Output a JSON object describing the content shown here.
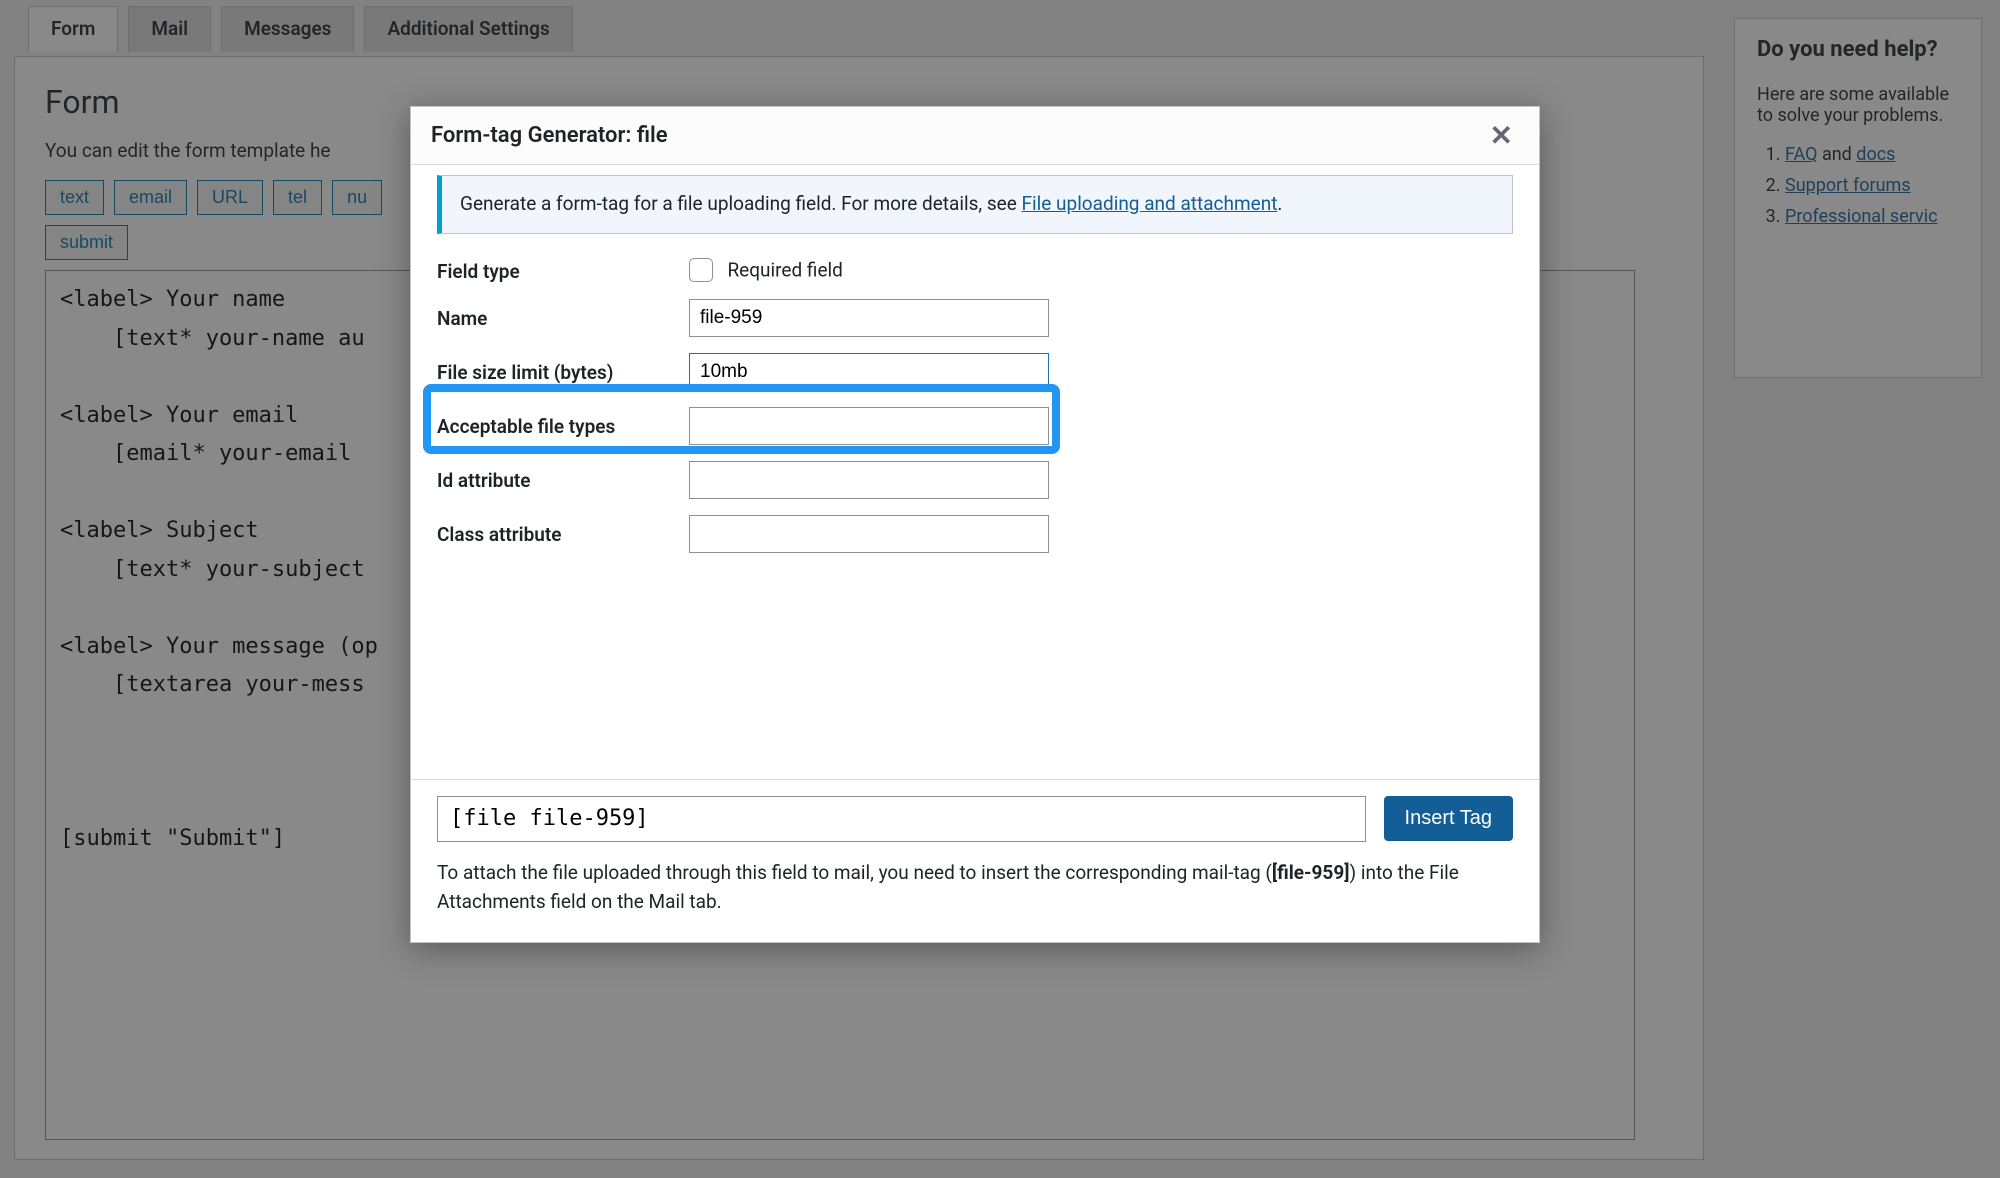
{
  "tabs": {
    "form": "Form",
    "mail": "Mail",
    "messages": "Messages",
    "additional": "Additional Settings"
  },
  "form_panel": {
    "heading": "Form",
    "sub": "You can edit the form template he",
    "buttons": {
      "text": "text",
      "email": "email",
      "url": "URL",
      "tel": "tel",
      "nu": "nu",
      "submit": "submit"
    },
    "editor": "<label> Your name\n    [text* your-name au\n\n<label> Your email\n    [email* your-email \n\n<label> Subject\n    [text* your-subject\n\n<label> Your message (op\n    [textarea your-mess\n\n\n\n[submit \"Submit\"]"
  },
  "help": {
    "heading": "Do you need help?",
    "para": "Here are some available to solve your problems.",
    "faq": "FAQ",
    "and": " and ",
    "docs": "docs",
    "support": "Support forums",
    "pro": "Professional servic"
  },
  "modal": {
    "title": "Form-tag Generator: file",
    "info_a": "Generate a form-tag for a file uploading field. For more details, see ",
    "info_link": "File uploading and attachment",
    "info_b": ".",
    "labels": {
      "field_type": "Field type",
      "required": "Required field",
      "name": "Name",
      "size_limit": "File size limit (bytes)",
      "acceptable": "Acceptable file types",
      "id_attr": "Id attribute",
      "class_attr": "Class attribute"
    },
    "values": {
      "name": "file-959",
      "size_limit": "10mb",
      "acceptable": "",
      "id_attr": "",
      "class_attr": ""
    },
    "tag_output": "[file file-959]",
    "insert_label": "Insert Tag",
    "footer_a": "To attach the file uploaded through this field to mail, you need to insert the corresponding mail-tag (",
    "footer_tag": "[file-959]",
    "footer_b": ") into the File Attachments field on the Mail tab."
  }
}
